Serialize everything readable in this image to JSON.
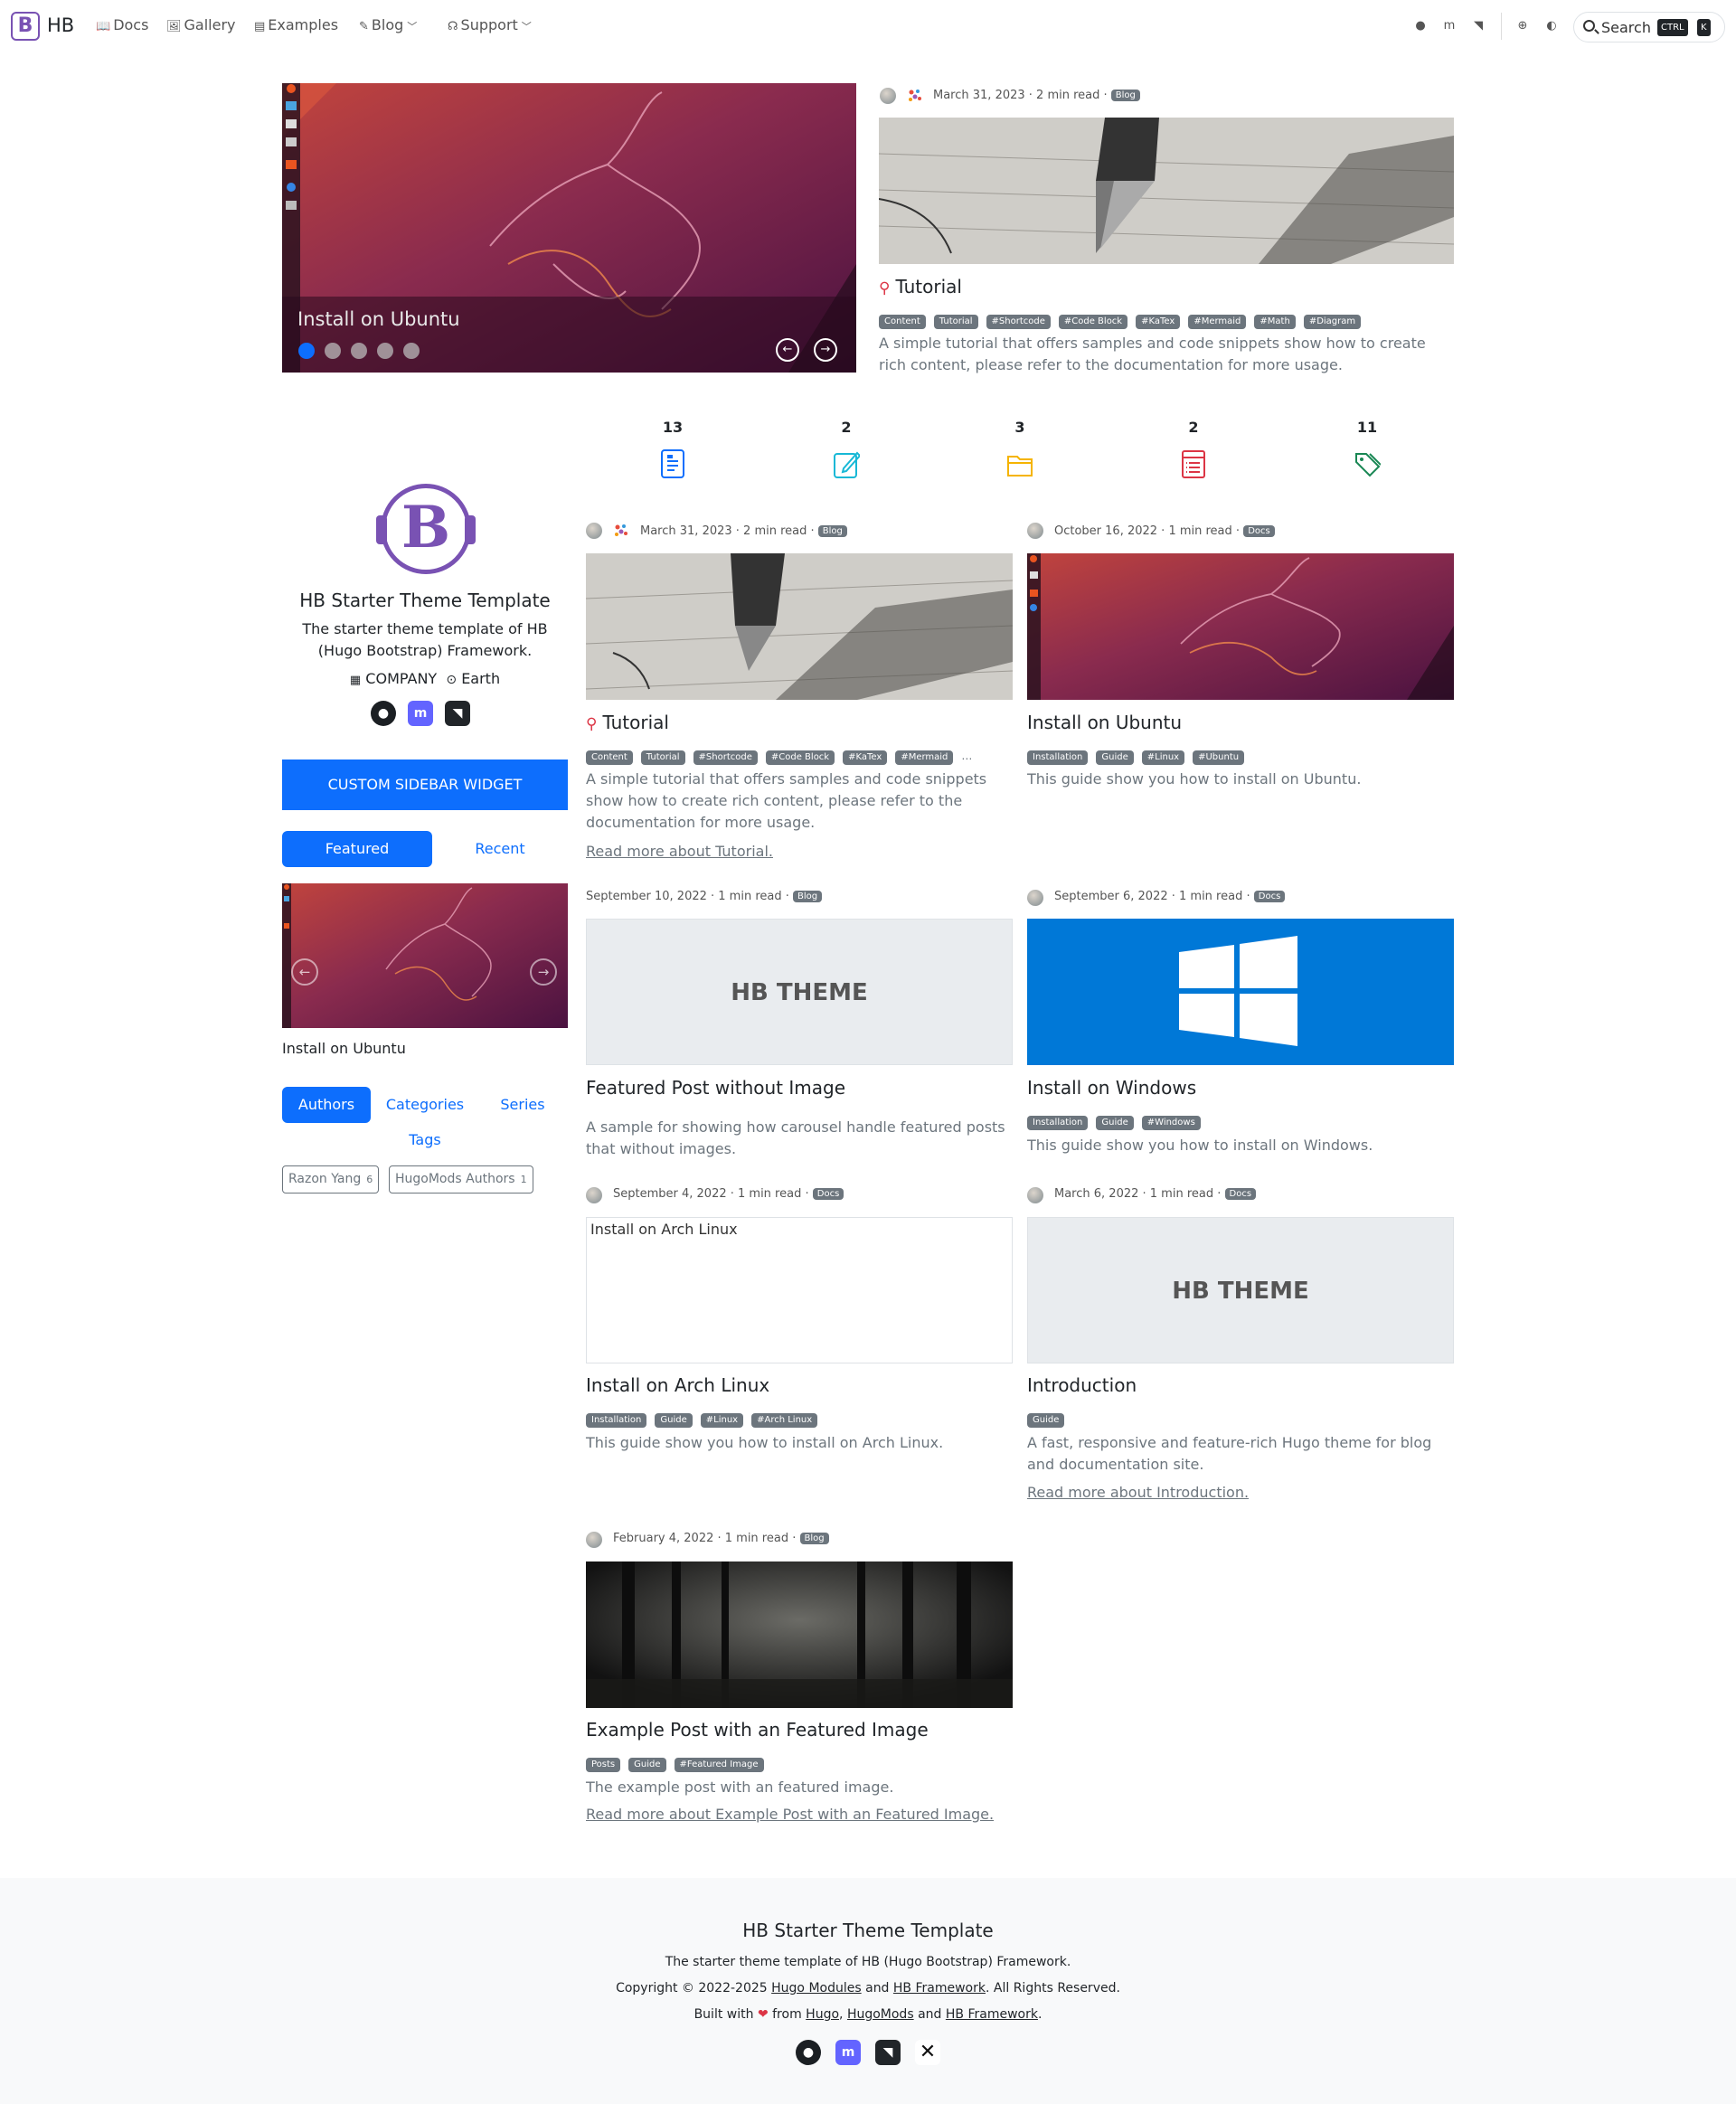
{
  "nav": {
    "brand": "HB",
    "docs": "Docs",
    "gallery": "Gallery",
    "examples": "Examples",
    "blog": "Blog",
    "support": "Support",
    "search": "Search",
    "kbd_ctrl": "CTRL",
    "kbd_k": "K"
  },
  "hero": {
    "carousel_caption": "Install on Ubuntu",
    "meta": "March 31, 2023 · 2 min read ·",
    "badge": "Blog",
    "title": "Tutorial",
    "tags": [
      "Content",
      "Tutorial",
      "#Shortcode",
      "#Code Block",
      "#KaTex",
      "#Mermaid",
      "#Math",
      "#Diagram"
    ],
    "summary": "A simple tutorial that offers samples and code snippets show how to create rich content, please refer to the documentation for more usage."
  },
  "stats": [
    {
      "count": "13",
      "icon": "file-text-icon",
      "color": "#0d6efd"
    },
    {
      "count": "2",
      "icon": "pencil-square-icon",
      "color": "#17b8d6"
    },
    {
      "count": "3",
      "icon": "folder-icon",
      "color": "#f5b400"
    },
    {
      "count": "2",
      "icon": "journal-list-icon",
      "color": "#dc3545"
    },
    {
      "count": "11",
      "icon": "tags-icon",
      "color": "#198754"
    }
  ],
  "sidebar": {
    "logo_letter": "B",
    "title": "HB Starter Theme Template",
    "description": "The starter theme template of HB (Hugo Bootstrap) Framework.",
    "company": "COMPANY",
    "location": "Earth",
    "widget_button": "CUSTOM SIDEBAR WIDGET",
    "tab_featured": "Featured",
    "tab_recent": "Recent",
    "featured_label": "Install on Ubuntu",
    "tab_authors": "Authors",
    "tab_categories": "Categories",
    "tab_series": "Series",
    "tab_tags": "Tags",
    "authors": [
      {
        "name": "Razon Yang",
        "count": "6"
      },
      {
        "name": "HugoMods Authors",
        "count": "1"
      }
    ]
  },
  "posts": {
    "p1": {
      "meta": "March 31, 2023 · 2 min read ·",
      "badge": "Blog",
      "title": "Tutorial",
      "tags": [
        "Content",
        "Tutorial",
        "#Shortcode",
        "#Code Block",
        "#KaTex",
        "#Mermaid"
      ],
      "more": "…",
      "summary": "A simple tutorial that offers samples and code snippets show how to create rich content, please refer to the documentation for more usage.",
      "readmore": "Read more about Tutorial."
    },
    "p2": {
      "meta": "October 16, 2022 · 1 min read ·",
      "badge": "Docs",
      "title": "Install on Ubuntu",
      "tags": [
        "Installation",
        "Guide",
        "#Linux",
        "#Ubuntu"
      ],
      "summary": "This guide show you how to install on Ubuntu."
    },
    "p3": {
      "meta": "September 10, 2022 · 1 min read ·",
      "badge": "Blog",
      "title": "Featured Post without Image",
      "image_text": "HB THEME",
      "summary": "A sample for showing how carousel handle featured posts that without images."
    },
    "p4": {
      "meta": "September 6, 2022 · 1 min read ·",
      "badge": "Docs",
      "title": "Install on Windows",
      "tags": [
        "Installation",
        "Guide",
        "#Windows"
      ],
      "summary": "This guide show you how to install on Windows."
    },
    "p5": {
      "meta": "September 4, 2022 · 1 min read ·",
      "badge": "Docs",
      "title": "Install on Arch Linux",
      "image_alt": "Install on Arch Linux",
      "tags": [
        "Installation",
        "Guide",
        "#Linux",
        "#Arch Linux"
      ],
      "summary": "This guide show you how to install on Arch Linux."
    },
    "p6": {
      "meta": "March 6, 2022 · 1 min read ·",
      "badge": "Docs",
      "title": "Introduction",
      "image_text": "HB THEME",
      "tags": [
        "Guide"
      ],
      "summary": "A fast, responsive and feature-rich Hugo theme for blog and documentation site.",
      "readmore": "Read more about Introduction."
    },
    "p7": {
      "meta": "February 4, 2022 · 1 min read ·",
      "badge": "Blog",
      "title": "Example Post with an Featured Image",
      "tags": [
        "Posts",
        "Guide",
        "#Featured Image"
      ],
      "summary": "The example post with an featured image.",
      "readmore": "Read more about Example Post with an Featured Image."
    }
  },
  "footer": {
    "title": "HB Starter Theme Template",
    "description": "The starter theme template of HB (Hugo Bootstrap) Framework.",
    "copyright_prefix": "Copyright © 2022-2025",
    "hugo_modules": "Hugo Modules",
    "and1": "and",
    "hb_framework": "HB Framework",
    "rights": ". All Rights Reserved.",
    "built_prefix": "Built with",
    "heart": "❤",
    "from": "from",
    "hugo": "Hugo",
    "comma": ",",
    "hugomods": "HugoMods",
    "and2": "and",
    "hb_framework2": "HB Framework",
    "period": "."
  },
  "colors": {
    "primary": "#0d6efd",
    "brand": "#7952b3",
    "badge": "#6c757d",
    "mastodon": "#6364ff"
  }
}
